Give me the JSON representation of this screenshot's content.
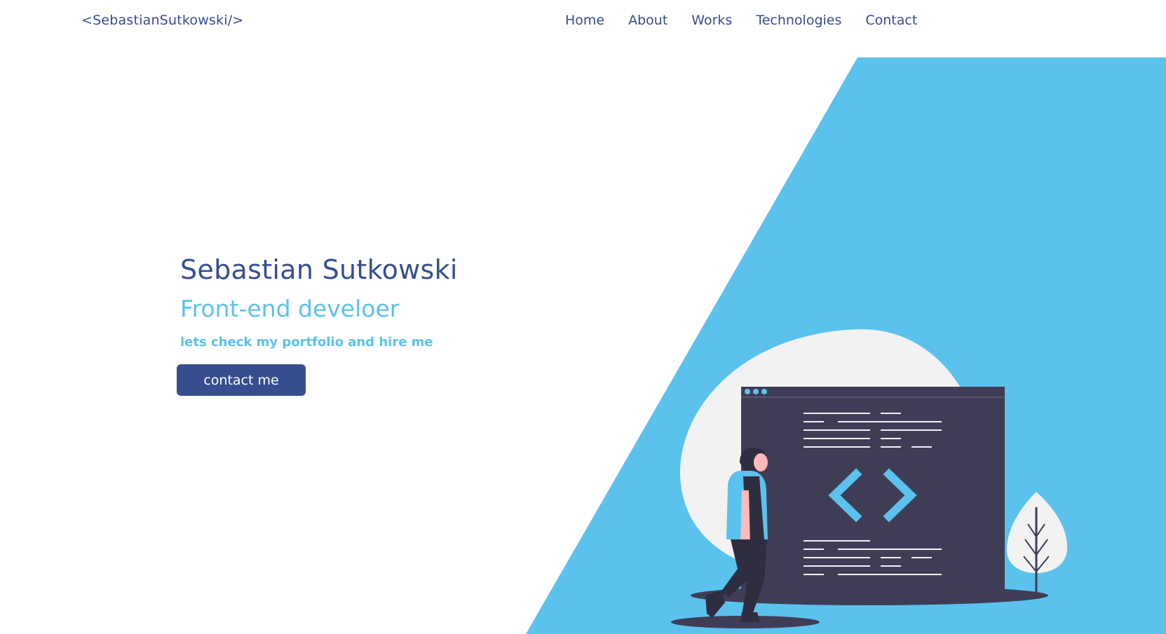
{
  "header": {
    "logo": "<SebastianSutkowski/>",
    "nav": [
      {
        "label": "Home"
      },
      {
        "label": "About"
      },
      {
        "label": "Works"
      },
      {
        "label": "Technologies"
      },
      {
        "label": "Contact"
      }
    ]
  },
  "hero": {
    "name": "Sebastian Sutkowski",
    "role": "Front-end develoer",
    "tagline": "lets check my portfolio and hire me",
    "cta_label": "contact me"
  },
  "colors": {
    "primary": "#364e8f",
    "accent": "#5bc2ee",
    "background": "#ffffff",
    "illustration_dark": "#3f3d56",
    "illustration_light": "#f2f2f2"
  },
  "illustration": {
    "icon": "code-window-developer-illustration"
  }
}
